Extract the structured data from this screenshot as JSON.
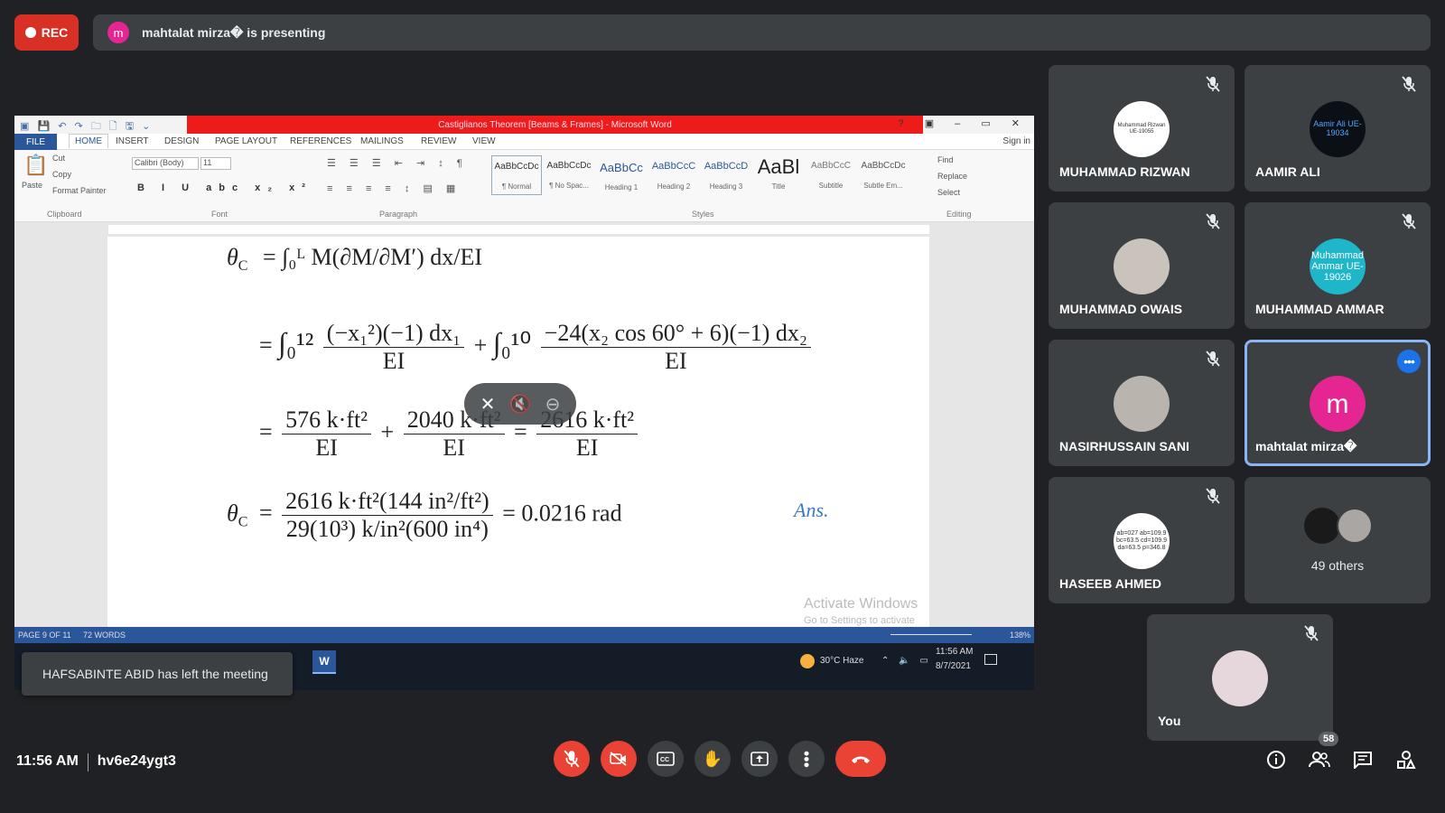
{
  "top": {
    "rec_label": "REC",
    "presenter_initial": "m",
    "presenting_text": "mahtalat mirza� is presenting"
  },
  "word": {
    "title": "Castiglianos Theorem [Beams & Frames] - Microsoft Word",
    "tabs": [
      "FILE",
      "HOME",
      "INSERT",
      "DESIGN",
      "PAGE LAYOUT",
      "REFERENCES",
      "MAILINGS",
      "REVIEW",
      "VIEW"
    ],
    "sign_in": "Sign in",
    "clipboard": {
      "paste": "Paste",
      "cut": "Cut",
      "copy": "Copy",
      "format_painter": "Format Painter",
      "group": "Clipboard"
    },
    "font": {
      "name": "Calibri (Body)",
      "size": "11",
      "group": "Font"
    },
    "paragraph_group": "Paragraph",
    "styles": [
      {
        "preview": "AaBbCcDc",
        "label": "¶ Normal"
      },
      {
        "preview": "AaBbCcDc",
        "label": "¶ No Spac..."
      },
      {
        "preview": "AaBbCc",
        "label": "Heading 1"
      },
      {
        "preview": "AaBbCcC",
        "label": "Heading 2"
      },
      {
        "preview": "AaBbCcD",
        "label": "Heading 3"
      },
      {
        "preview": "AaBl",
        "label": "Title"
      },
      {
        "preview": "AaBbCcC",
        "label": "Subtitle"
      },
      {
        "preview": "AaBbCcDc",
        "label": "Subtle Em..."
      }
    ],
    "styles_group": "Styles",
    "editing": {
      "find": "Find",
      "replace": "Replace",
      "select": "Select",
      "group": "Editing"
    },
    "equations": {
      "l1_lhs": "θ",
      "l1_sub": "C",
      "l1_rhs": "= ∫₀ᴸ M(∂M/∂M′) dx/EI",
      "l2_a_num": "(−x₁²)(−1) dx₁",
      "l2_a_den": "EI",
      "l2_b_num": "−24(x₂ cos 60° + 6)(−1) dx₂",
      "l2_b_den": "EI",
      "l2_int_a": "∫₀¹²",
      "l2_int_b": "∫₀¹⁰",
      "l3_a_num": "576 k·ft²",
      "l3_b_num": "2040 k·ft²",
      "l3_c_num": "2616 k·ft²",
      "l3_den": "EI",
      "l4_num": "2616 k·ft²(144 in²/ft²)",
      "l4_den": "29(10³) k/in²(600 in⁴)",
      "l4_result": "= 0.0216 rad",
      "ans": "Ans."
    },
    "activate_title": "Activate Windows",
    "activate_sub": "Go to Settings to activate Windows.",
    "status_page": "PAGE 9 OF 11",
    "status_words": "72 WORDS",
    "zoom": "138%",
    "weather": "30°C  Haze",
    "clock_time": "11:56 AM",
    "clock_date": "8/7/2021"
  },
  "toast": "HAFSABINTE ABID has left the meeting",
  "participants": [
    {
      "name": "MUHAMMAD RIZWAN",
      "avatar_text": "Muhammad Rizwan UE-19055",
      "bg": "#ffffff",
      "fg": "#333333"
    },
    {
      "name": "AAMIR ALI",
      "avatar_text": "Aamir Ali UE-19034",
      "bg": "#0b0f16",
      "fg": "#4fa8ff"
    },
    {
      "name": "MUHAMMAD OWAIS",
      "avatar_text": "",
      "bg": "#c9c3bb",
      "fg": "#333333"
    },
    {
      "name": "MUHAMMAD AMMAR",
      "avatar_text": "Muhammad Ammar UE-19026",
      "bg": "#1fb6c9",
      "fg": "#ffffff"
    },
    {
      "name": "NASIRHUSSAIN SANI",
      "avatar_text": "",
      "bg": "#b9b4ae",
      "fg": "#333333"
    },
    {
      "name": "mahtalat mirza�",
      "avatar_text": "m",
      "bg": "#e52592",
      "fg": "#ffffff"
    },
    {
      "name": "HASEEB AHMED",
      "avatar_text": "ab=027 ab=109.9 bc=63.5 cd=109.9 da=63.5 p=346.8",
      "bg": "#ffffff",
      "fg": "#333333"
    },
    {
      "name": "49 others",
      "avatar_text": "",
      "bg": "#555555",
      "fg": "#ffffff"
    },
    {
      "name": "You",
      "avatar_text": "",
      "bg": "#e6d7dc",
      "fg": "#333333"
    }
  ],
  "bottom": {
    "time": "11:56 AM",
    "meeting_code": "hv6e24ygt3",
    "people_count": "58"
  }
}
